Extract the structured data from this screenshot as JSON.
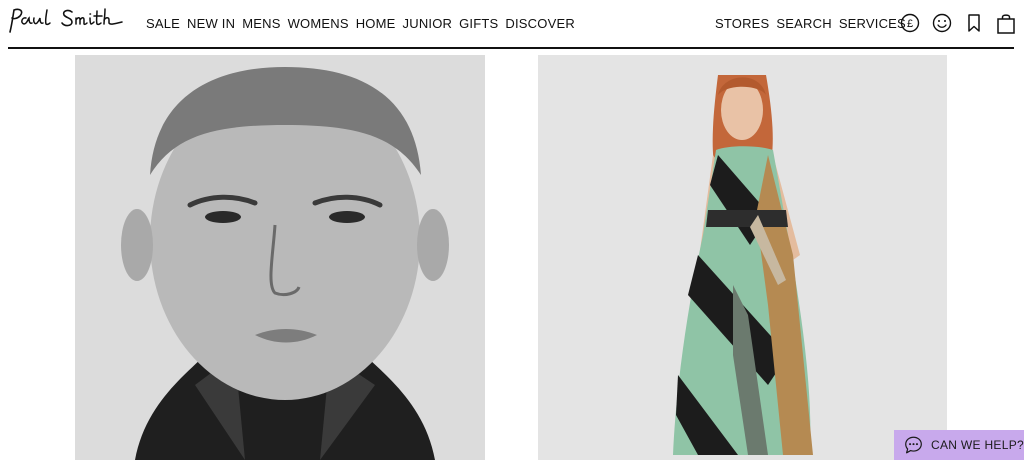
{
  "brand": {
    "logo_text": "Paul Smith"
  },
  "nav": {
    "primary": [
      "SALE",
      "NEW IN",
      "MENS",
      "WOMENS",
      "HOME",
      "JUNIOR",
      "GIFTS",
      "DISCOVER"
    ],
    "utility": [
      "STORES",
      "SEARCH",
      "SERVICES"
    ]
  },
  "icons": {
    "currency": "currency-pound-icon",
    "account": "account-smiley-icon",
    "wishlist": "bookmark-icon",
    "bag": "shopping-bag-icon",
    "currency_symbol": "£"
  },
  "tiles": [
    {
      "name": "mens-editorial-image",
      "subject": "black-and-white portrait"
    },
    {
      "name": "womens-editorial-image",
      "subject": "model in printed maxi dress"
    }
  ],
  "help_widget": {
    "label": "CAN WE HELP?",
    "icon": "chat-bubble-icon"
  },
  "colors": {
    "help_bg": "#c8a9ec",
    "text": "#111111",
    "rule": "#111111"
  }
}
